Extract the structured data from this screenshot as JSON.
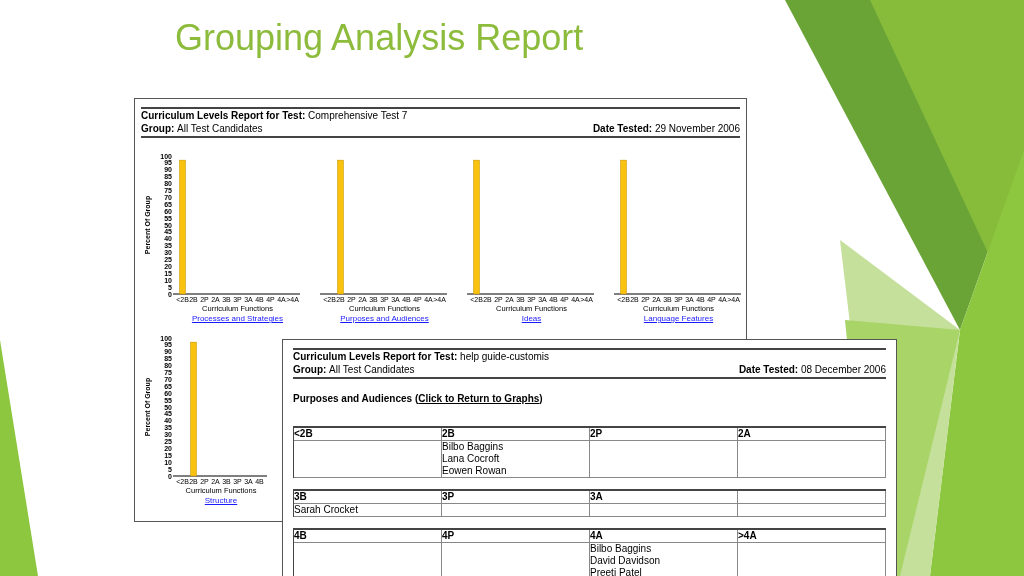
{
  "slide": {
    "title": "Grouping Analysis Report"
  },
  "report_1": {
    "title_label": "Curriculum Levels Report for Test:",
    "test_name": "Comprehensive Test 7",
    "group_label": "Group:",
    "group": "All Test Candidates",
    "date_label": "Date Tested:",
    "date": "29 November 2006",
    "charts": [
      {
        "link": "Processes and Strategies",
        "chart_data": {
          "type": "bar",
          "xlabel": "Curriculum Functions",
          "ylabel": "Percent Of Group",
          "categories": [
            "<2B",
            "2B",
            "2P",
            "2A",
            "3B",
            "3P",
            "3A",
            "4B",
            "4P",
            "4A",
            ">4A"
          ],
          "values": [
            97,
            0,
            0,
            0,
            0,
            0,
            0,
            0,
            0,
            0,
            0
          ],
          "ylim": [
            0,
            100
          ],
          "yticks": [
            0,
            5,
            10,
            15,
            20,
            25,
            30,
            35,
            40,
            45,
            50,
            55,
            60,
            65,
            70,
            75,
            80,
            85,
            90,
            95,
            100
          ]
        }
      },
      {
        "link": "Purposes and Audiences",
        "chart_data": {
          "type": "bar",
          "xlabel": "Curriculum Functions",
          "categories": [
            "<2B",
            "2B",
            "2P",
            "2A",
            "3B",
            "3P",
            "3A",
            "4B",
            "4P",
            "4A",
            ">4A"
          ],
          "values": [
            0,
            97,
            0,
            0,
            0,
            0,
            0,
            0,
            0,
            0,
            0
          ],
          "ylim": [
            0,
            100
          ]
        }
      },
      {
        "link": "Ideas",
        "chart_data": {
          "type": "bar",
          "xlabel": "Curriculum Functions",
          "categories": [
            "<2B",
            "2B",
            "2P",
            "2A",
            "3B",
            "3P",
            "3A",
            "4B",
            "4P",
            "4A",
            ">4A"
          ],
          "values": [
            97,
            0,
            0,
            0,
            0,
            0,
            0,
            0,
            0,
            0,
            0
          ],
          "ylim": [
            0,
            100
          ]
        }
      },
      {
        "link": "Language Features",
        "chart_data": {
          "type": "bar",
          "xlabel": "Curriculum Functions",
          "categories": [
            "<2B",
            "2B",
            "2P",
            "2A",
            "3B",
            "3P",
            "3A",
            "4B",
            "4P",
            "4A",
            ">4A"
          ],
          "values": [
            97,
            0,
            0,
            0,
            0,
            0,
            0,
            0,
            0,
            0,
            0
          ],
          "ylim": [
            0,
            100
          ]
        }
      },
      {
        "link": "Structure",
        "chart_data": {
          "type": "bar",
          "xlabel": "Curriculum Functions",
          "ylabel": "Percent Of Group",
          "categories": [
            "<2B",
            "2B",
            "2P",
            "2A",
            "3B",
            "3P",
            "3A",
            "4B"
          ],
          "values": [
            0,
            97,
            0,
            0,
            0,
            0,
            0,
            0
          ],
          "ylim": [
            0,
            100
          ],
          "yticks": [
            0,
            5,
            10,
            15,
            20,
            25,
            30,
            35,
            40,
            45,
            50,
            55,
            60,
            65,
            70,
            75,
            80,
            85,
            90,
            95,
            100
          ]
        }
      }
    ]
  },
  "report_2": {
    "title_label": "Curriculum Levels Report for Test:",
    "test_name": "help guide-customis",
    "group_label": "Group:",
    "group": "All Test Candidates",
    "date_label": "Date Tested:",
    "date": "08 December 2006",
    "section_title": "Purposes and Audiences",
    "link_open": "(",
    "link": "Click to Return to Graphs",
    "link_close": ")",
    "tables": [
      {
        "columns": [
          {
            "heading": "<2B"
          },
          {
            "heading": "2B",
            "names": [
              "Bilbo Baggins",
              "Lana Cocroft",
              "Eowen Rowan"
            ]
          },
          {
            "heading": "2P"
          },
          {
            "heading": "2A"
          }
        ]
      },
      {
        "columns": [
          {
            "heading": "3B",
            "names": [
              "Sarah Crocket"
            ]
          },
          {
            "heading": "3P"
          },
          {
            "heading": "3A"
          }
        ]
      },
      {
        "columns": [
          {
            "heading": "4B"
          },
          {
            "heading": "4P"
          },
          {
            "heading": "4A",
            "names": [
              "Bilbo Baggins",
              "David Davidson",
              "Preeti Patel"
            ]
          },
          {
            "heading": ">4A"
          }
        ]
      }
    ]
  }
}
